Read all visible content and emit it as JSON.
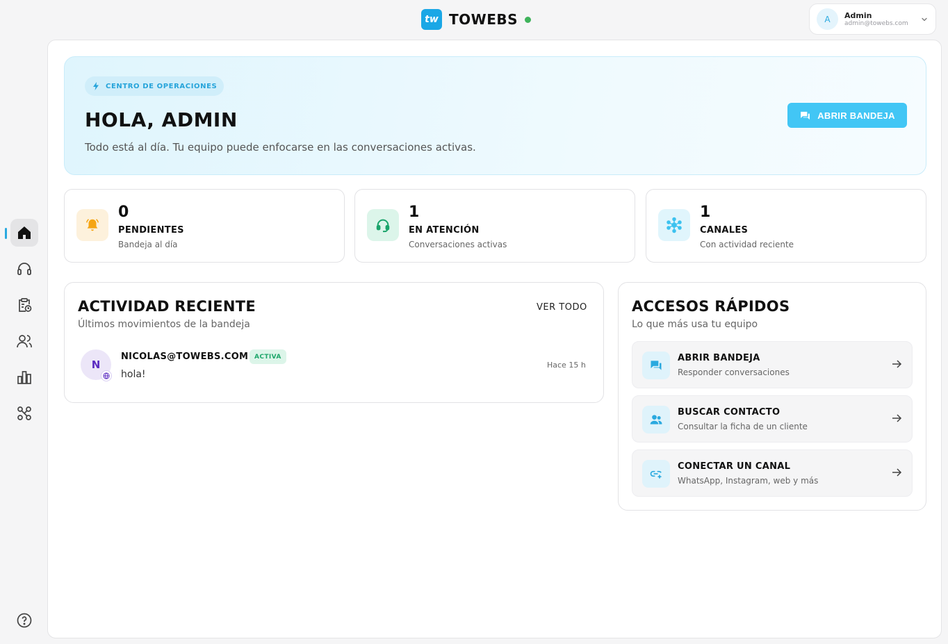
{
  "brand": {
    "logo": "tw",
    "name": "TOWEBS"
  },
  "user": {
    "initial": "A",
    "name": "Admin",
    "email": "admin@towebs.com",
    "chevron": "⌄"
  },
  "sidebar": {
    "items": [
      "home-icon",
      "headset-icon",
      "clipboard-clock-icon",
      "users-icon",
      "bar-chart-icon",
      "network-icon"
    ],
    "help": "help-icon"
  },
  "hero": {
    "chip": "CENTRO DE OPERACIONES",
    "title": "HOLA, ADMIN",
    "subtitle": "Todo está al día. Tu equipo puede enfocarse en las conversaciones activas.",
    "button": "ABRIR BANDEJA"
  },
  "stats": [
    {
      "value": "0",
      "label": "PENDIENTES",
      "desc": "Bandeja al día",
      "icon": "bell-icon",
      "color": "#f5a514"
    },
    {
      "value": "1",
      "label": "EN ATENCIÓN",
      "desc": "Conversaciones activas",
      "icon": "headset-icon",
      "color": "#1aa46b"
    },
    {
      "value": "1",
      "label": "CANALES",
      "desc": "Con actividad reciente",
      "icon": "hub-icon",
      "color": "#3cc2ef"
    }
  ],
  "activity": {
    "title": "ACTIVIDAD RECIENTE",
    "subtitle": "Últimos movimientos de la bandeja",
    "view_all": "VER TODO",
    "items": [
      {
        "initial": "N",
        "name": "NICOLAS@TOWEBS.COM",
        "status": "ACTIVA",
        "message": "hola!",
        "time": "Hace 15 h"
      }
    ]
  },
  "quick": {
    "title": "ACCESOS RÁPIDOS",
    "subtitle": "Lo que más usa tu equipo",
    "items": [
      {
        "label": "ABRIR BANDEJA",
        "desc": "Responder conversaciones",
        "icon": "chat-icon"
      },
      {
        "label": "BUSCAR CONTACTO",
        "desc": "Consultar la ficha de un cliente",
        "icon": "contacts-icon"
      },
      {
        "label": "CONECTAR UN CANAL",
        "desc": "WhatsApp, Instagram, web y más",
        "icon": "link-plus-icon"
      }
    ]
  },
  "colors": {
    "accent": "#42c6f5",
    "brand": "#1aa7e6",
    "online": "#3fb35b"
  }
}
